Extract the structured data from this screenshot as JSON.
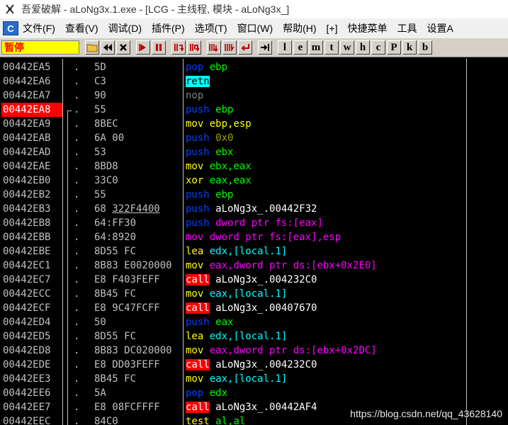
{
  "window": {
    "title": "吾爱破解 - aLoNg3x.1.exe - [LCG - 主线程, 模块 - aLoNg3x_]",
    "icon": "crack-bug-icon"
  },
  "menu": {
    "c_label": "C",
    "items": [
      "文件(F)",
      "查看(V)",
      "调试(D)",
      "插件(P)",
      "选项(T)",
      "窗口(W)",
      "帮助(H)",
      "[+]",
      "快捷菜单",
      "工具",
      "设置A"
    ]
  },
  "toolbar": {
    "status": "暂停",
    "letters": [
      "l",
      "e",
      "m",
      "t",
      "w",
      "h",
      "c",
      "P",
      "k",
      "b"
    ]
  },
  "disasm": {
    "rows": [
      {
        "addr": "00442EA5",
        "hex": "5D",
        "mn": "pop",
        "ops": "ebp",
        "mnc": "c-blue",
        "opc": "c-green"
      },
      {
        "addr": "00442EA6",
        "hex": "C3",
        "mn": "retn",
        "ops": "",
        "mnc": "hl-cyan",
        "opc": ""
      },
      {
        "addr": "00442EA7",
        "hex": "90",
        "mn": "nop",
        "ops": "",
        "mnc": "c-gray",
        "opc": ""
      },
      {
        "addr": "00442EA8",
        "hex": "55",
        "mn": "push",
        "ops": "ebp",
        "mnc": "c-blue",
        "opc": "c-green",
        "sel": true
      },
      {
        "addr": "00442EA9",
        "hex": "8BEC",
        "mn": "mov",
        "ops": "ebp,esp",
        "mnc": "c-yellow",
        "opc": "c-yellow"
      },
      {
        "addr": "00442EAB",
        "hex": "6A 00",
        "mn": "push",
        "ops": "0x0",
        "mnc": "c-blue",
        "opc": "c-olive"
      },
      {
        "addr": "00442EAD",
        "hex": "53",
        "mn": "push",
        "ops": "ebx",
        "mnc": "c-blue",
        "opc": "c-green"
      },
      {
        "addr": "00442EAE",
        "hex": "8BD8",
        "mn": "mov",
        "ops": "ebx,eax",
        "mnc": "c-yellow",
        "opc": "c-green"
      },
      {
        "addr": "00442EB0",
        "hex": "33C0",
        "mn": "xor",
        "ops": "eax,eax",
        "mnc": "c-yellow",
        "opc": "c-green"
      },
      {
        "addr": "00442EB2",
        "hex": "55",
        "mn": "push",
        "ops": "ebp",
        "mnc": "c-blue",
        "opc": "c-green"
      },
      {
        "addr": "00442EB3",
        "hex": "68 322F4400",
        "mn": "push",
        "ops": "aLoNg3x_.00442F32",
        "mnc": "c-blue",
        "opc": "c-white",
        "ul": true
      },
      {
        "addr": "00442EB8",
        "hex": "64:FF30",
        "mn": "push",
        "ops": "dword ptr fs:[eax]",
        "mnc": "c-blue",
        "opc": "c-magenta"
      },
      {
        "addr": "00442EBB",
        "hex": "64:8920",
        "mn": "mov",
        "ops": "dword ptr fs:[eax],esp",
        "mnc": "c-magenta",
        "opc": "c-magenta"
      },
      {
        "addr": "00442EBE",
        "hex": "8D55 FC",
        "mn": "lea",
        "ops": "edx,[local.1]",
        "mnc": "c-yellow",
        "opc": "c-cyan"
      },
      {
        "addr": "00442EC1",
        "hex": "8B83 E0020000",
        "mn": "mov",
        "ops": "eax,dword ptr ds:[ebx+0x2E0]",
        "mnc": "c-yellow",
        "opc": "c-magenta"
      },
      {
        "addr": "00442EC7",
        "hex": "E8 F403FEFF",
        "mn": "call",
        "ops": "aLoNg3x_.004232C0",
        "mnc": "hl-red",
        "opc": "c-white"
      },
      {
        "addr": "00442ECC",
        "hex": "8B45 FC",
        "mn": "mov",
        "ops": "eax,[local.1]",
        "mnc": "c-yellow",
        "opc": "c-cyan"
      },
      {
        "addr": "00442ECF",
        "hex": "E8 9C47FCFF",
        "mn": "call",
        "ops": "aLoNg3x_.00407670",
        "mnc": "hl-red",
        "opc": "c-white"
      },
      {
        "addr": "00442ED4",
        "hex": "50",
        "mn": "push",
        "ops": "eax",
        "mnc": "c-blue",
        "opc": "c-green"
      },
      {
        "addr": "00442ED5",
        "hex": "8D55 FC",
        "mn": "lea",
        "ops": "edx,[local.1]",
        "mnc": "c-yellow",
        "opc": "c-cyan"
      },
      {
        "addr": "00442ED8",
        "hex": "8B83 DC020000",
        "mn": "mov",
        "ops": "eax,dword ptr ds:[ebx+0x2DC]",
        "mnc": "c-yellow",
        "opc": "c-magenta"
      },
      {
        "addr": "00442EDE",
        "hex": "E8 DD03FEFF",
        "mn": "call",
        "ops": "aLoNg3x_.004232C0",
        "mnc": "hl-red",
        "opc": "c-white"
      },
      {
        "addr": "00442EE3",
        "hex": "8B45 FC",
        "mn": "mov",
        "ops": "eax,[local.1]",
        "mnc": "c-yellow",
        "opc": "c-cyan"
      },
      {
        "addr": "00442EE6",
        "hex": "5A",
        "mn": "pop",
        "ops": "edx",
        "mnc": "c-blue",
        "opc": "c-green"
      },
      {
        "addr": "00442EE7",
        "hex": "E8 08FCFFFF",
        "mn": "call",
        "ops": "aLoNg3x_.00442AF4",
        "mnc": "hl-red",
        "opc": "c-white"
      },
      {
        "addr": "00442EEC",
        "hex": "84C0",
        "mn": "test",
        "ops": "al,al",
        "mnc": "c-yellow",
        "opc": "c-green"
      }
    ]
  },
  "watermark": "https://blog.csdn.net/qq_43628140"
}
